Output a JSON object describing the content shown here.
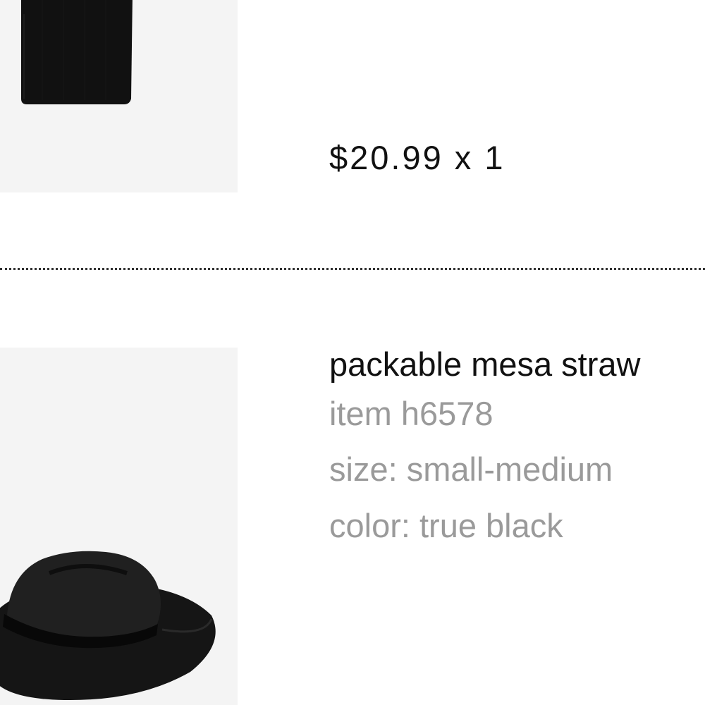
{
  "cart": {
    "items": [
      {
        "thumbnail": {
          "icon": "black-garment-image",
          "background": "#f4f4f4"
        },
        "price": "$20.99",
        "quantity": "1",
        "price_qty_text": "$20.99 x 1"
      },
      {
        "thumbnail": {
          "icon": "black-straw-hat-image",
          "background": "#f4f4f4"
        },
        "name": "packable mesa straw",
        "item_number": "item h6578",
        "size": "size: small-medium",
        "color": "color: true black"
      }
    ]
  },
  "colors": {
    "text_primary": "#111111",
    "text_secondary": "#9a9a9a",
    "divider": "#333333"
  }
}
